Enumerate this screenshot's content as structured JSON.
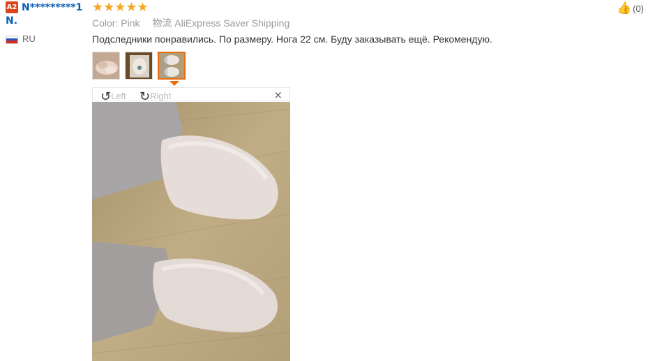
{
  "reviewer": {
    "level_badge": "A2",
    "name": "N*********1",
    "name_line2": "N.",
    "country": "RU"
  },
  "review": {
    "stars": "★★★★★",
    "rating": 5,
    "color_label": "Color:",
    "color_value": "Pink",
    "shipping_label": "物流",
    "shipping_value": "AliExpress Saver Shipping",
    "text": "Подследники понравились. По размеру. Нога 22 см. Буду заказывать ещё. Рекомендую.",
    "thumbnails": [
      "thumbnail-1",
      "thumbnail-2",
      "thumbnail-3"
    ],
    "active_thumbnail": 2
  },
  "viewer": {
    "rotate_left_label": "Left",
    "rotate_right_label": "Right",
    "close_symbol": "×"
  },
  "like": {
    "count": "(0)"
  },
  "colors": {
    "accent": "#e86d12",
    "name_blue": "#0a5fb4",
    "star": "#f6a623",
    "badge": "#d9451d"
  }
}
